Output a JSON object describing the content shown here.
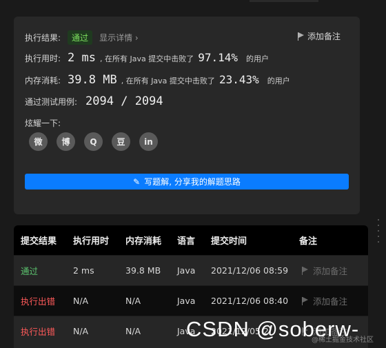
{
  "result": {
    "label": "执行结果:",
    "status": "通过",
    "details_link": "显示详情 ›",
    "add_note": "添加备注"
  },
  "runtime": {
    "label": "执行用时:",
    "value": "2 ms",
    "text": ", 在所有 Java 提交中击败了",
    "percent": "97.14%",
    "suffix": "的用户"
  },
  "memory": {
    "label": "内存消耗:",
    "value": "39.8 MB",
    "text": ", 在所有 Java 提交中击败了",
    "percent": "23.43%",
    "suffix": "的用户"
  },
  "tests": {
    "label": "通过测试用例:",
    "value": "2094 / 2094"
  },
  "share": {
    "label": "炫耀一下:",
    "icons": [
      "wechat-icon",
      "weibo-icon",
      "qq-icon",
      "douban-icon",
      "linkedin-icon"
    ],
    "glyphs": [
      "微",
      "博",
      "Q",
      "豆",
      "in"
    ]
  },
  "write_solution": "写题解, 分享我的解题思路",
  "table": {
    "headers": [
      "提交结果",
      "执行用时",
      "内存消耗",
      "语言",
      "提交时间",
      "备注"
    ],
    "rows": [
      {
        "status": "通过",
        "time": "2 ms",
        "memory": "39.8 MB",
        "lang": "Java",
        "submitted": "2021/12/06 08:59",
        "note": "添加备注"
      },
      {
        "status": "执行出错",
        "time": "N/A",
        "memory": "N/A",
        "lang": "Java",
        "submitted": "2021/12/06 08:40",
        "note": "添加备注"
      },
      {
        "status": "执行出错",
        "time": "N/A",
        "memory": "N/A",
        "lang": "Java",
        "submitted": "2021/12/05 2",
        "note": "添加备注"
      }
    ]
  },
  "watermark": {
    "main": "CSDN @soberw-",
    "sub": "@稀土掘金技术社区"
  },
  "colors": {
    "accent": "#0a7cff",
    "pass": "#5cc36f",
    "error": "#ff5a5a"
  }
}
